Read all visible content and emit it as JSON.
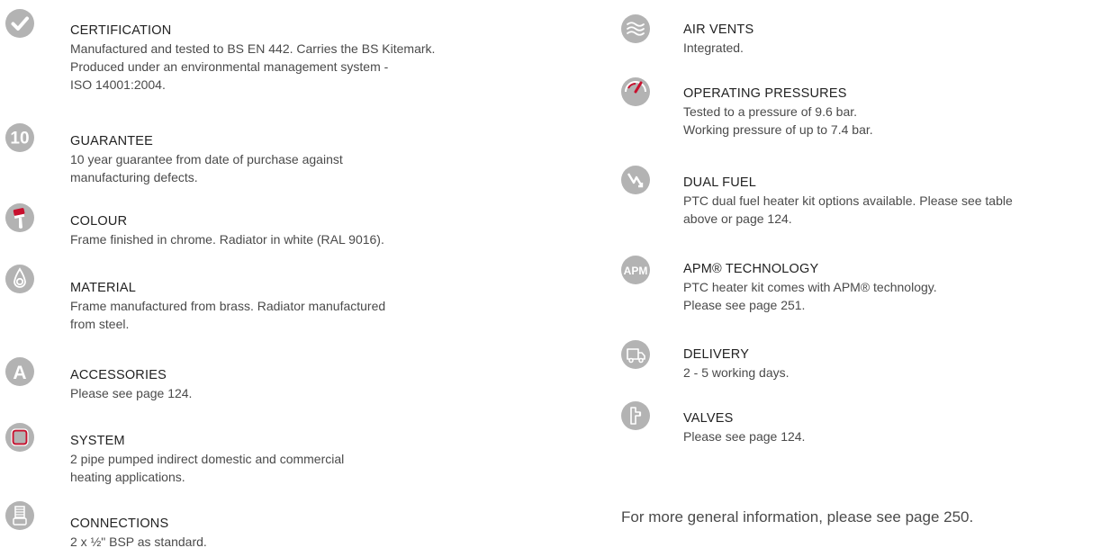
{
  "colors": {
    "icon_grey": "#b3b3b3",
    "accent_red": "#c8102e"
  },
  "left_features": [
    {
      "icon": "check-icon",
      "title": "CERTIFICATION",
      "lines": [
        "Manufactured and tested to BS EN 442. Carries the BS Kitemark.",
        "Produced under an environmental management system -",
        "ISO 14001:2004."
      ]
    },
    {
      "icon": "ten-year-icon",
      "icon_text": "10",
      "title": "GUARANTEE",
      "lines": [
        "10 year guarantee from date of purchase against",
        "manufacturing defects."
      ]
    },
    {
      "icon": "paintbrush-icon",
      "title": "COLOUR",
      "lines": [
        "Frame finished in chrome. Radiator in white (RAL 9016)."
      ]
    },
    {
      "icon": "material-drop-icon",
      "title": "MATERIAL",
      "lines": [
        "Frame manufactured from brass. Radiator manufactured",
        "from steel."
      ]
    },
    {
      "icon": "accessories-a-icon",
      "icon_text": "A",
      "title": "ACCESSORIES",
      "lines": [
        "Please see page 124."
      ]
    },
    {
      "icon": "system-loop-icon",
      "title": "SYSTEM",
      "lines": [
        "2 pipe pumped indirect domestic and commercial",
        "heating applications."
      ]
    },
    {
      "icon": "connection-fitting-icon",
      "title": "CONNECTIONS",
      "lines": [
        "2 x ½\" BSP as standard."
      ]
    }
  ],
  "right_features": [
    {
      "icon": "air-waves-icon",
      "title": "AIR VENTS",
      "lines": [
        "Integrated."
      ]
    },
    {
      "icon": "pressure-gauge-icon",
      "title": "OPERATING PRESSURES",
      "lines": [
        "Tested to a pressure of 9.6 bar.",
        "Working pressure of up to 7.4 bar."
      ]
    },
    {
      "icon": "dual-fuel-icon",
      "title": "DUAL FUEL",
      "lines": [
        "PTC dual fuel heater kit options available. Please see table",
        "above or page 124."
      ]
    },
    {
      "icon": "apm-icon",
      "icon_text": "APM",
      "title": "APM® TECHNOLOGY",
      "lines": [
        "PTC heater kit comes with APM® technology.",
        "Please see page 251."
      ]
    },
    {
      "icon": "delivery-truck-icon",
      "title": "DELIVERY",
      "lines": [
        "2 - 5 working days."
      ]
    },
    {
      "icon": "valve-icon",
      "title": "VALVES",
      "lines": [
        "Please see page 124."
      ]
    }
  ],
  "footer_note": "For more general information, please see page 250."
}
